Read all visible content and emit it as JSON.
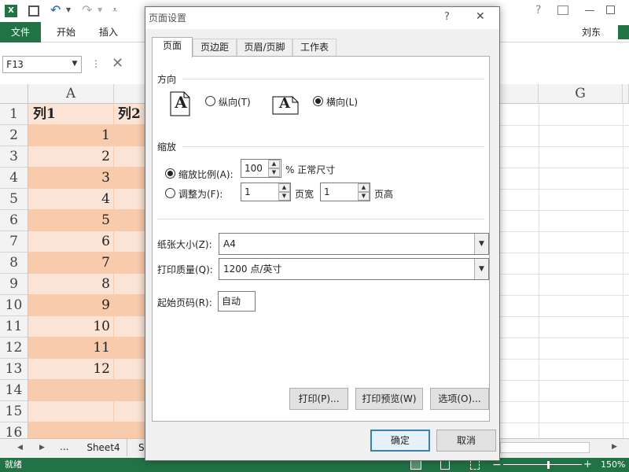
{
  "window": {
    "title_bar": {
      "excel_icon": "excel-icon",
      "save_icon": "save-icon",
      "undo_icon": "undo-icon",
      "redo_icon": "redo-icon"
    }
  },
  "ribbon": {
    "file_tab": "文件",
    "tabs": [
      "开始",
      "插入"
    ],
    "user": "刘东"
  },
  "formula_bar": {
    "name_box": "F13"
  },
  "sheet": {
    "columns": [
      "A",
      "G"
    ],
    "col_a_header": "列1",
    "col_b_header": "列2",
    "rows": [
      "1",
      "2",
      "3",
      "4",
      "5",
      "6",
      "7",
      "8",
      "9",
      "10",
      "11",
      "12",
      "13",
      "14",
      "15",
      "16"
    ],
    "values": [
      "1",
      "2",
      "3",
      "4",
      "5",
      "6",
      "7",
      "8",
      "9",
      "10",
      "11",
      "12"
    ]
  },
  "sheet_tabs": {
    "ellipsis": "...",
    "tab1": "Sheet4",
    "tab2": "S"
  },
  "status_bar": {
    "ready": "就绪",
    "zoom": "150%"
  },
  "dialog": {
    "title": "页面设置",
    "help": "?",
    "close": "✕",
    "tabs": [
      "页面",
      "页边距",
      "页眉/页脚",
      "工作表"
    ],
    "orientation": {
      "section": "方向",
      "portrait": "纵向(T)",
      "landscape": "横向(L)",
      "selected": "landscape"
    },
    "scaling": {
      "section": "缩放",
      "adjust_to_label": "缩放比例(A):",
      "adjust_to_value": "100",
      "adjust_to_suffix": "% 正常尺寸",
      "fit_to_label": "调整为(F):",
      "pages_wide": "1",
      "pages_wide_label": "页宽",
      "pages_tall": "1",
      "pages_tall_label": "页高",
      "selected": "adjust"
    },
    "paper_size_label": "纸张大小(Z):",
    "paper_size_value": "A4",
    "print_quality_label": "打印质量(Q):",
    "print_quality_value": "1200 点/英寸",
    "first_page_label": "起始页码(R):",
    "first_page_value": "自动",
    "buttons": {
      "print": "打印(P)...",
      "preview": "打印预览(W)",
      "options": "选项(O)...",
      "ok": "确定",
      "cancel": "取消"
    }
  }
}
